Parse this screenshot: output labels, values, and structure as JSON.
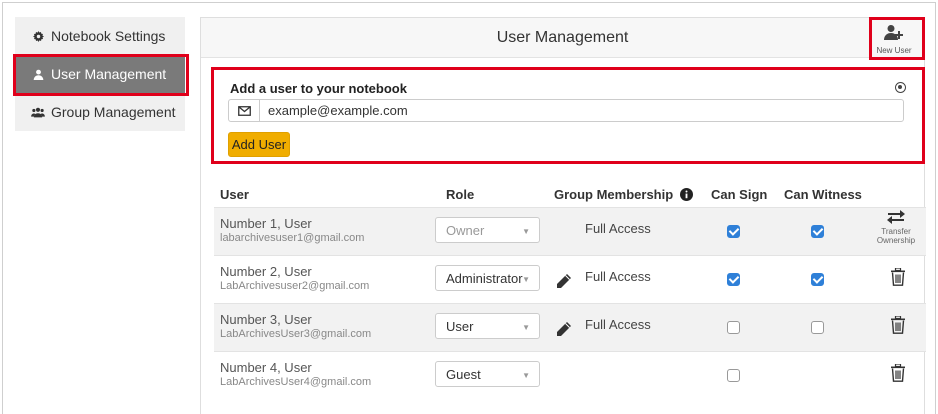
{
  "sidebar": {
    "items": [
      {
        "label": "Notebook Settings",
        "icon": "gear-icon",
        "active": false
      },
      {
        "label": "User Management",
        "icon": "user-icon",
        "active": true
      },
      {
        "label": "Group Management",
        "icon": "users-icon",
        "active": false
      }
    ]
  },
  "header": {
    "title": "User Management",
    "new_user_label": "New User"
  },
  "add_user": {
    "title": "Add a user to your notebook",
    "email_value": "example@example.com",
    "button_label": "Add User"
  },
  "table": {
    "headers": {
      "user": "User",
      "role": "Role",
      "group": "Group Membership",
      "can_sign": "Can Sign",
      "can_witness": "Can Witness"
    },
    "rows": [
      {
        "name": "Number 1, User",
        "email": "labarchivesuser1@gmail.com",
        "role": "Owner",
        "group": "Full Access",
        "can_sign": true,
        "can_witness": true,
        "action": "Transfer Ownership"
      },
      {
        "name": "Number 2, User",
        "email": "LabArchivesuser2@gmail.com",
        "role": "Administrator",
        "group": "Full Access",
        "can_sign": true,
        "can_witness": true
      },
      {
        "name": "Number 3, User",
        "email": "LabArchivesUser3@gmail.com",
        "role": "User",
        "group": "Full Access",
        "can_sign": false,
        "can_witness": false
      },
      {
        "name": "Number 4, User",
        "email": "LabArchivesUser4@gmail.com",
        "role": "Guest",
        "group": "",
        "can_sign": false,
        "can_witness": null
      }
    ],
    "transfer_line1": "Transfer",
    "transfer_line2": "Ownership"
  },
  "colors": {
    "accent_red": "#e0001b",
    "button_yellow": "#f0ad00",
    "checkbox_blue": "#2f80d8",
    "active_sidebar": "#7a7a7a"
  }
}
